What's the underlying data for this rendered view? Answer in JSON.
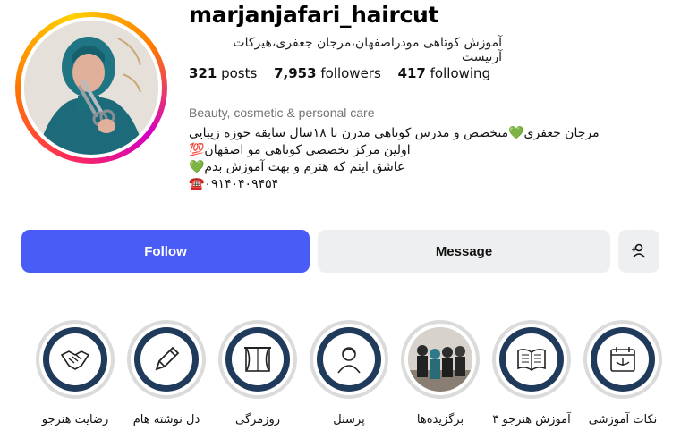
{
  "profile": {
    "username": "marjanjafari_haircut",
    "more_label": "···",
    "full_name": "آموزش کوتاهی مودراصفهان،مرجان جعفری،هیرکات آرتیست",
    "stats": [
      {
        "num": "321",
        "label": "posts"
      },
      {
        "num": "7,953",
        "label": "followers"
      },
      {
        "num": "417",
        "label": "following"
      }
    ],
    "category": "Beauty, cosmetic & personal care",
    "bio": [
      "مرجان جعفری💚متخصص و مدرس کوتاهی مدرن با ۱۸سال سابقه حوزه زیبایی",
      "اولین مرکز تخصصی کوتاهی مو اصفهان💯",
      "عاشق اینم که هنرم و بهت آموزش بدم💚",
      "☎️۰۹۱۴۰۴۰۹۴۵۴"
    ]
  },
  "actions": {
    "follow_label": "Follow",
    "message_label": "Message",
    "add_user_icon": "person-plus-icon"
  },
  "highlights": [
    {
      "label": "رضایت هنرجو",
      "icon": "handshake-icon"
    },
    {
      "label": "دل نوشته هام",
      "icon": "pencil-icon"
    },
    {
      "label": "روزمرگی",
      "icon": "window-curtains-icon"
    },
    {
      "label": "پرسنل",
      "icon": "person-icon"
    },
    {
      "label": "برگزیده‌ها",
      "icon": "group-photo"
    },
    {
      "label": "آموزش هنرجو ۴",
      "icon": "book-icon"
    },
    {
      "label": "نکات آموزشی",
      "icon": "calendar-icon"
    }
  ],
  "colors": {
    "follow_button": "#4a5cf6",
    "secondary_button": "#eeeff1",
    "highlight_disc": "#1f3a5a",
    "category_text": "#737373"
  }
}
